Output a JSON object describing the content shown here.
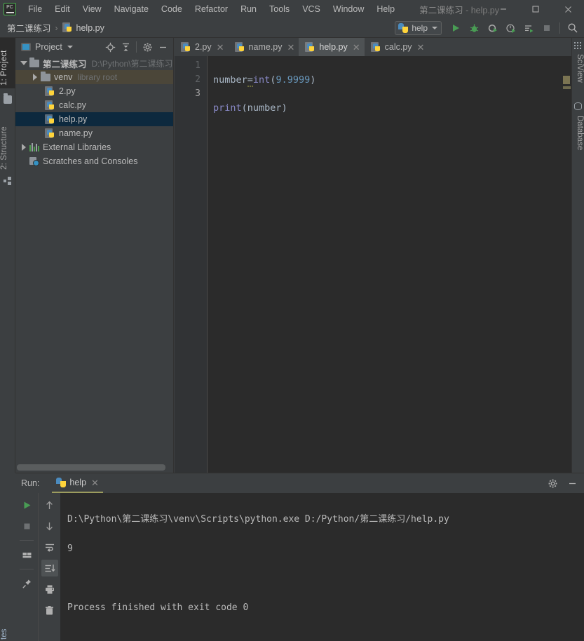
{
  "titlebar": {
    "logo": "PC",
    "menus": [
      {
        "label": "File",
        "mnemonic": "F"
      },
      {
        "label": "Edit",
        "mnemonic": "E"
      },
      {
        "label": "View",
        "mnemonic": "V"
      },
      {
        "label": "Navigate",
        "mnemonic": "N"
      },
      {
        "label": "Code",
        "mnemonic": "C"
      },
      {
        "label": "Refactor",
        "mnemonic": "R"
      },
      {
        "label": "Run",
        "mnemonic": "u"
      },
      {
        "label": "Tools",
        "mnemonic": "T"
      },
      {
        "label": "VCS",
        "mnemonic": "S"
      },
      {
        "label": "Window",
        "mnemonic": "W"
      },
      {
        "label": "Help",
        "mnemonic": "H"
      }
    ],
    "window_title_project": "第二课练习",
    "window_title_rest": " - help.py",
    "minimize": "minimize-button",
    "maximize": "maximize-button",
    "close": "close-button"
  },
  "navbar": {
    "breadcrumb_project": "第二课练习",
    "breadcrumb_separator": "›",
    "breadcrumb_file": "help.py",
    "run_config": "help",
    "buttons": [
      {
        "name": "run-button",
        "title": "Run"
      },
      {
        "name": "debug-button",
        "title": "Debug"
      },
      {
        "name": "run-coverage-button",
        "title": "Run with Coverage"
      },
      {
        "name": "profile-button",
        "title": "Profile"
      },
      {
        "name": "run-console-button",
        "title": "Run with Console"
      },
      {
        "name": "stop-button",
        "title": "Stop"
      },
      {
        "name": "search-everywhere-button",
        "title": "Search Everywhere"
      }
    ]
  },
  "left_strip": {
    "project_label": "1: Project",
    "structure_label": "2: Structure",
    "bottom_label": "tes"
  },
  "right_strip": {
    "sciview_label": "SciView",
    "database_label": "Database"
  },
  "project_panel": {
    "title": "Project",
    "header_buttons": [
      {
        "name": "locate-file-icon"
      },
      {
        "name": "collapse-all-icon"
      },
      {
        "name": "gear-icon"
      },
      {
        "name": "hide-panel-icon"
      }
    ],
    "tree": [
      {
        "label": "第二课练习",
        "path": "D:\\Python\\第二课练习",
        "kind": "project-root",
        "depth": 0,
        "expanded": true,
        "state": "normal"
      },
      {
        "label": "venv",
        "path": "library root",
        "kind": "folder",
        "depth": 1,
        "expanded": false,
        "state": "hover"
      },
      {
        "label": "2.py",
        "path": "",
        "kind": "python-file",
        "depth": 2,
        "state": "normal"
      },
      {
        "label": "calc.py",
        "path": "",
        "kind": "python-file",
        "depth": 2,
        "state": "normal"
      },
      {
        "label": "help.py",
        "path": "",
        "kind": "python-file",
        "depth": 2,
        "state": "selected"
      },
      {
        "label": "name.py",
        "path": "",
        "kind": "python-file",
        "depth": 2,
        "state": "normal"
      },
      {
        "label": "External Libraries",
        "path": "",
        "kind": "libraries",
        "depth": 0,
        "expanded": false,
        "state": "normal"
      },
      {
        "label": "Scratches and Consoles",
        "path": "",
        "kind": "scratches",
        "depth": 0,
        "state": "normal"
      }
    ]
  },
  "editor": {
    "tabs": [
      {
        "label": "2.py",
        "active": false
      },
      {
        "label": "name.py",
        "active": false
      },
      {
        "label": "help.py",
        "active": true
      },
      {
        "label": "calc.py",
        "active": false
      }
    ],
    "close_glyph": "✕",
    "line_numbers": [
      "1",
      "2",
      "3"
    ],
    "current_line": 3,
    "code_lines": [
      {
        "tokens": [
          {
            "text": "number",
            "type": "var"
          },
          {
            "text": "=",
            "type": "op",
            "warn": true
          },
          {
            "text": "int",
            "type": "fn"
          },
          {
            "text": "(",
            "type": "pn"
          },
          {
            "text": "9.9999",
            "type": "num"
          },
          {
            "text": ")",
            "type": "pn"
          }
        ]
      },
      {
        "tokens": [
          {
            "text": "print",
            "type": "fn"
          },
          {
            "text": "(",
            "type": "pn"
          },
          {
            "text": "number",
            "type": "var"
          },
          {
            "text": ")",
            "type": "pn"
          }
        ]
      },
      {
        "tokens": []
      }
    ]
  },
  "run_panel": {
    "label": "Run:",
    "tab_label": "help",
    "close_glyph": "✕",
    "header_buttons": [
      {
        "name": "settings-gear-icon"
      },
      {
        "name": "hide-panel-icon"
      }
    ],
    "left_tools": [
      {
        "name": "rerun-button",
        "selected": false
      },
      {
        "name": "stop-button",
        "selected": false
      },
      {
        "name": "restore-layout-button",
        "selected": false
      },
      {
        "name": "pin-tab-button",
        "selected": false
      }
    ],
    "right_tools": [
      {
        "name": "up-arrow-button",
        "selected": false
      },
      {
        "name": "down-arrow-button",
        "selected": false
      },
      {
        "name": "soft-wrap-button",
        "selected": false
      },
      {
        "name": "scroll-to-end-button",
        "selected": true
      },
      {
        "name": "print-button",
        "selected": false
      },
      {
        "name": "clear-all-button",
        "selected": false
      }
    ],
    "console_lines": [
      "D:\\Python\\第二课练习\\venv\\Scripts\\python.exe D:/Python/第二课练习/help.py",
      "9",
      "",
      "Process finished with exit code 0"
    ]
  },
  "colors": {
    "panel_bg": "#3c3f41",
    "editor_bg": "#2b2b2b",
    "selection_blue": "#0d293e",
    "hover_olive": "#4b4639",
    "accent_green": "#4caf50",
    "python_blue": "#4b8bbe",
    "python_yellow": "#ffd43b",
    "number_blue": "#6897bb",
    "function_violet": "#8888c6",
    "text_default": "#a9b7c6"
  }
}
